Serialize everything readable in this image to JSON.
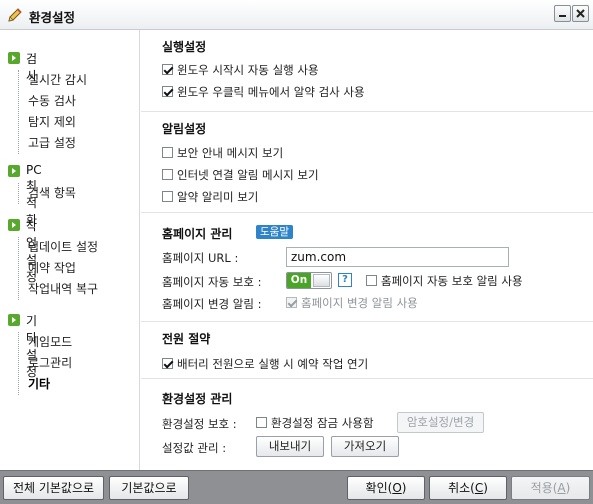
{
  "window": {
    "title": "환경설정",
    "icon": "pencil-icon",
    "minimize_glyph": "–",
    "close_glyph": "✕"
  },
  "sidebar": {
    "bullet_color": "#58a82e",
    "groups": [
      {
        "label": "검사",
        "items": [
          "실시간 감시",
          "수동 검사",
          "탐지 제외",
          "고급 설정"
        ]
      },
      {
        "label": "PC 최적화",
        "items": [
          "검색 항목"
        ]
      },
      {
        "label": "작업 설정",
        "items": [
          "업데이트 설정",
          "예약 작업",
          "작업내역 복구"
        ]
      },
      {
        "label": "기타 설정",
        "items": [
          "게임모드",
          "로그관리",
          "기타"
        ]
      }
    ],
    "active_item": "기타"
  },
  "sections": {
    "run": {
      "title": "실행설정",
      "opt1": {
        "label": "윈도우 시작시 자동 실행 사용",
        "checked": true
      },
      "opt2": {
        "label": "윈도우 우클릭 메뉴에서 알약 검사 사용",
        "checked": true
      }
    },
    "alert": {
      "title": "알림설정",
      "opt1": {
        "label": "보안 안내 메시지 보기",
        "checked": false
      },
      "opt2": {
        "label": "인터넷 연결 알림 메시지 보기",
        "checked": false
      },
      "opt3": {
        "label": "알약 알리미 보기",
        "checked": false
      }
    },
    "homepage": {
      "title": "홈페이지 관리",
      "help_label": "도움말",
      "url_label": "홈페이지 URL :",
      "url_value": "zum.com",
      "protect_label": "홈페이지 자동 보호 :",
      "toggle_label": "On",
      "toggle_on": true,
      "help_icon": "?",
      "protect_alert": {
        "label": "홈페이지 자동 보호 알림 사용",
        "checked": false
      },
      "change_label": "홈페이지 변경 알림 :",
      "change_alert": {
        "label": "홈페이지 변경 알림 사용",
        "checked": true,
        "disabled": true
      }
    },
    "power": {
      "title": "전원 절약",
      "opt1": {
        "label": "배터리 전원으로 실행 시 예약 작업 연기",
        "checked": true
      }
    },
    "env": {
      "title": "환경설정 관리",
      "protect_label": "환경설정 보호 :",
      "lock": {
        "label": "환경설정 잠금 사용함",
        "checked": false
      },
      "password_button": "암호설정/변경",
      "manage_label": "설정값 관리 :",
      "export_button": "내보내기",
      "import_button": "가져오기"
    }
  },
  "footer": {
    "reset_all": "전체 기본값으로",
    "reset": "기본값으로",
    "ok_text": "확인(",
    "ok_key": "O",
    "cancel_text": "취소(",
    "cancel_key": "C",
    "apply_text": "적용(",
    "apply_key": "A",
    "close_paren": ")"
  }
}
